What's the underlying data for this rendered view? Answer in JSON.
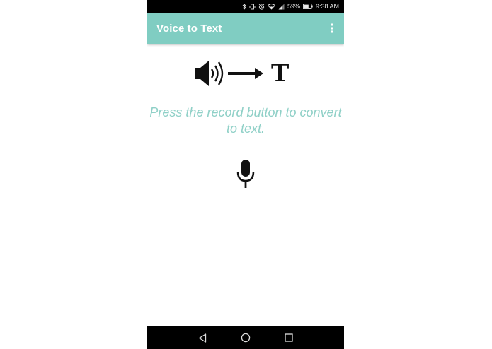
{
  "status_bar": {
    "battery_percent": "59%",
    "time": "9:38 AM",
    "icons": [
      "bluetooth-icon",
      "vibrate-icon",
      "alarm-icon",
      "wifi-icon",
      "signal-icon",
      "battery-icon"
    ]
  },
  "app_bar": {
    "title": "Voice to Text",
    "menu_icon": "overflow-menu-icon",
    "background_color": "#80cdc2"
  },
  "main": {
    "illustration": {
      "icons": [
        "speaker-icon",
        "arrow-right-icon"
      ],
      "letter": "T"
    },
    "instruction": "Press the record button to convert to text.",
    "instruction_color": "#8fd0c7",
    "record_button_icon": "microphone-icon"
  },
  "nav_bar": {
    "icons": [
      "back-icon",
      "home-icon",
      "recents-icon"
    ]
  }
}
